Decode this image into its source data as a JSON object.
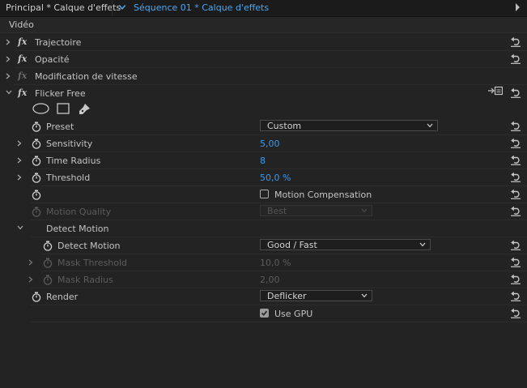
{
  "tabs": {
    "panel_tab": "Principal * Calque d'effets",
    "sequence_tab": "Séquence 01 * Calque d'effets"
  },
  "section": {
    "title": "Vidéo"
  },
  "effects": [
    {
      "label": "Trajectoire"
    },
    {
      "label": "Opacité"
    },
    {
      "label": "Modification de vitesse"
    },
    {
      "label": "Flicker Free"
    }
  ],
  "flicker": {
    "preset": {
      "label": "Preset",
      "value": "Custom"
    },
    "sensitivity": {
      "label": "Sensitivity",
      "value": "5,00"
    },
    "time_radius": {
      "label": "Time Radius",
      "value": "8"
    },
    "threshold": {
      "label": "Threshold",
      "value": "50,0 %"
    },
    "motion_comp": {
      "label": "Motion Compensation",
      "checked": false
    },
    "motion_quality": {
      "label": "Motion Quality",
      "value": "Best"
    },
    "detect_group": {
      "label": "Detect Motion"
    },
    "detect_motion": {
      "label": "Detect Motion",
      "value": "Good / Fast"
    },
    "mask_threshold": {
      "label": "Mask Threshold",
      "value": "10,0 %"
    },
    "mask_radius": {
      "label": "Mask Radius",
      "value": "2,00"
    },
    "render": {
      "label": "Render",
      "value": "Deflicker"
    },
    "use_gpu": {
      "label": "Use GPU",
      "checked": true
    }
  },
  "colors": {
    "accent": "#3f9ae8",
    "background": "#232323",
    "text": "#bdbdbd"
  },
  "icons": [
    "fx-icon",
    "stopwatch-icon",
    "reset-icon",
    "ellipse-mask-icon",
    "rectangle-mask-icon",
    "pen-mask-icon",
    "panel-menu-icon",
    "expand-chevron-icon"
  ]
}
